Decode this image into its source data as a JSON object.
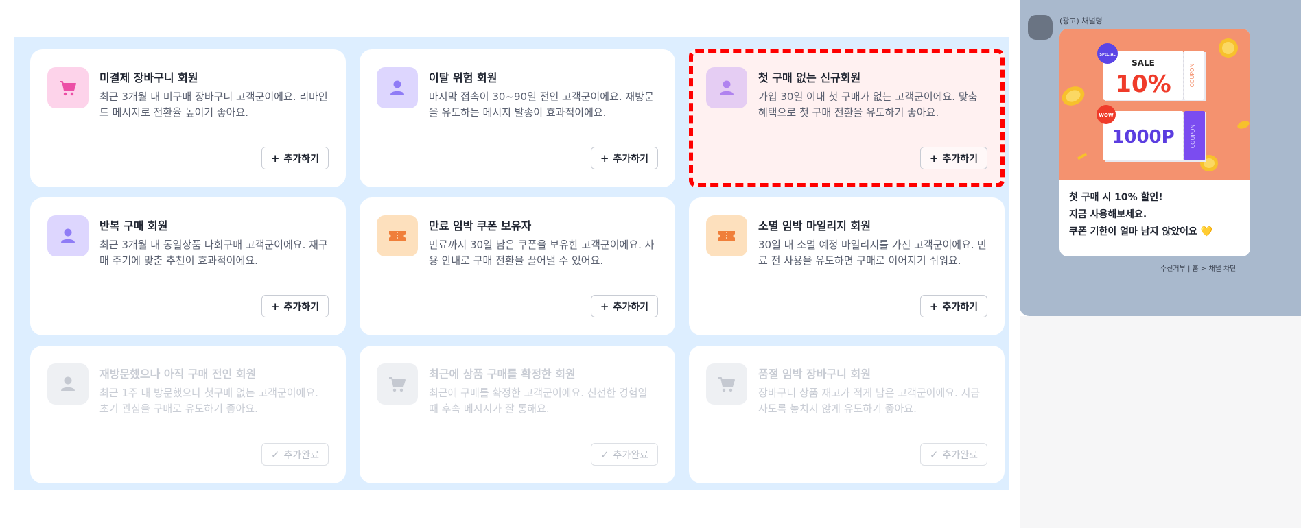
{
  "segments": [
    {
      "title": "미결제 장바구니 회원",
      "desc": "최근 3개월 내 미구매 장바구니 고객군이에요. 리마인드 메시지로 전환율 높이기 좋아요.",
      "action": "추가하기",
      "icon": "shopping-cart-icon",
      "icon_color": "#ec4fa6",
      "icon_bg": "#fdd3ea",
      "state": "add"
    },
    {
      "title": "이탈 위험 회원",
      "desc": "마지막 접속이 30~90일 전인 고객군이에요. 재방문을 유도하는 메시지 발송이 효과적이에요.",
      "action": "추가하기",
      "icon": "user-icon",
      "icon_color": "#8f7cf6",
      "icon_bg": "#ddd6fe",
      "state": "add"
    },
    {
      "title": "첫 구매 없는 신규회원",
      "desc": "가입 30일 이내 첫 구매가 없는 고객군이에요. 맞춤 혜택으로 첫 구매 전환을 유도하기 좋아요.",
      "action": "추가하기",
      "icon": "user-icon",
      "icon_color": "#b083ef",
      "icon_bg": "#e5cdf3",
      "state": "add"
    },
    {
      "title": "반복 구매 회원",
      "desc": "최근 3개월 내 동일상품 다회구매 고객군이에요. 재구매 주기에 맞춘 추천이 효과적이에요.",
      "action": "추가하기",
      "icon": "user-icon",
      "icon_color": "#8f7cf6",
      "icon_bg": "#ddd6fe",
      "state": "add"
    },
    {
      "title": "만료 임박 쿠폰 보유자",
      "desc": "만료까지 30일 남은 쿠폰을 보유한 고객군이에요. 사용 안내로 구매 전환을 끌어낼 수 있어요.",
      "action": "추가하기",
      "icon": "ticket-icon",
      "icon_color": "#f07f3a",
      "icon_bg": "#fde0bd",
      "state": "add"
    },
    {
      "title": "소멸 임박 마일리지 회원",
      "desc": "30일 내 소멸 예정 마일리지를 가진 고객군이에요. 만료 전 사용을 유도하면 구매로 이어지기 쉬워요.",
      "action": "추가하기",
      "icon": "ticket-icon",
      "icon_color": "#f07f3a",
      "icon_bg": "#fde0bd",
      "state": "add"
    },
    {
      "title": "재방문했으나 아직 구매 전인 회원",
      "desc": "최근 1주 내 방문했으나 첫구매 없는 고객군이에요. 초기 관심을 구매로 유도하기 좋아요.",
      "action": "추가완료",
      "icon": "user-icon",
      "icon_color": "#c5c9d1",
      "icon_bg": "#eef0f3",
      "state": "done"
    },
    {
      "title": "최근에 상품 구매를 확정한 회원",
      "desc": "최근에 구매를 확정한 고객군이에요. 신선한 경험일 때 후속 메시지가 잘 통해요.",
      "action": "추가완료",
      "icon": "shopping-cart-icon",
      "icon_color": "#c5c9d1",
      "icon_bg": "#eef0f3",
      "state": "done"
    },
    {
      "title": "품절 임박 장바구니 회원",
      "desc": "장바구니 상품 재고가 적게 남은 고객군이에요. 지금 사도록 놓치지 않게 유도하기 좋아요.",
      "action": "추가완료",
      "icon": "shopping-cart-icon",
      "icon_color": "#c5c9d1",
      "icon_bg": "#eef0f3",
      "state": "done"
    }
  ],
  "preview": {
    "channel_name": "(광고) 채널명",
    "promo": {
      "badge1": "SPECIAL",
      "sale": "SALE",
      "percent": "10%",
      "coupon_tag": "COUPON",
      "badge2": "WOW",
      "points": "1000P"
    },
    "message_lines": [
      "첫 구매 시 10% 할인!",
      "지금 사용해보세요.",
      "쿠폰 기한이 얼마 남지 않았어요 💛"
    ],
    "footer": "수신거부 | 홈 > 채널 차단"
  },
  "colors": {
    "panel_bg": "#ddeeff",
    "highlight_border": "#ff0000",
    "highlight_bg": "#fff1f1",
    "preview_bg": "#a9b9cd",
    "promo_bg": "#f4926f",
    "coupon_purple": "#7b4cf0",
    "sale_red": "#ef3b2a"
  }
}
